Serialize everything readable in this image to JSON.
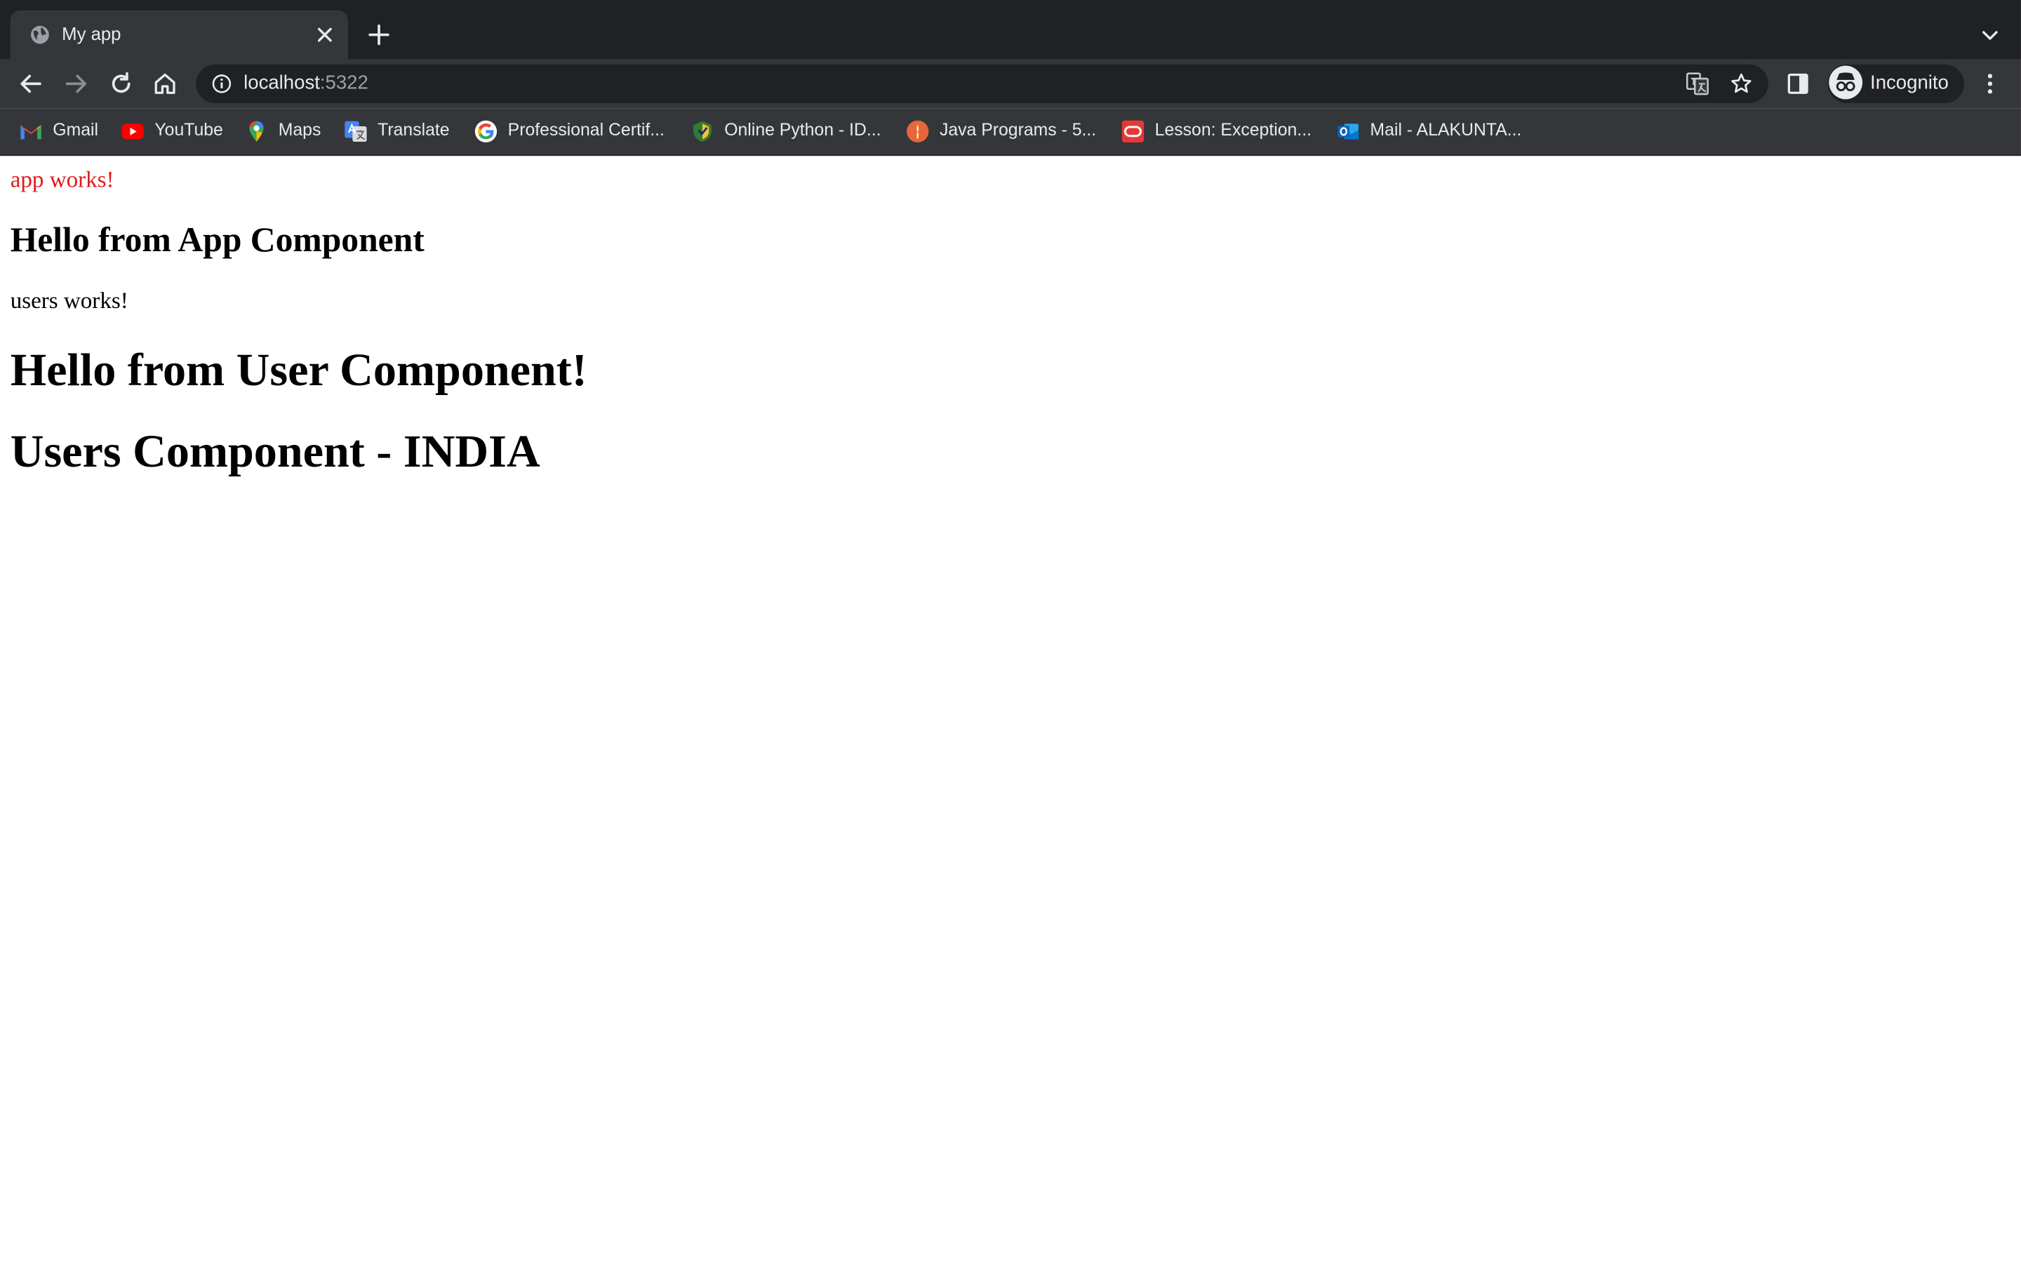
{
  "browser": {
    "tab": {
      "title": "My app"
    },
    "address": {
      "host": "localhost",
      "port": ":5322"
    },
    "profile": {
      "label": "Incognito"
    },
    "bookmarks": [
      {
        "label": "Gmail",
        "icon": "gmail-icon"
      },
      {
        "label": "YouTube",
        "icon": "youtube-icon"
      },
      {
        "label": "Maps",
        "icon": "maps-icon"
      },
      {
        "label": "Translate",
        "icon": "translate-icon"
      },
      {
        "label": "Professional Certif...",
        "icon": "google-icon"
      },
      {
        "label": "Online Python - ID...",
        "icon": "python-ide-icon"
      },
      {
        "label": "Java Programs - 5...",
        "icon": "java-programs-icon"
      },
      {
        "label": "Lesson: Exception...",
        "icon": "oracle-icon"
      },
      {
        "label": "Mail - ALAKUNTA...",
        "icon": "outlook-icon"
      }
    ]
  },
  "page": {
    "app_status": "app works!",
    "app_heading": "Hello from App Component",
    "users_status": "users works!",
    "user_heading": "Hello from User Component!",
    "country_heading": "Users Component - INDIA"
  },
  "colors": {
    "app_status_text": "#e21a1a",
    "chrome_dark": "#202124",
    "chrome_tab": "#35363a"
  }
}
